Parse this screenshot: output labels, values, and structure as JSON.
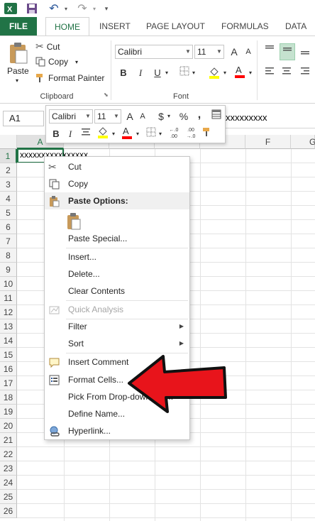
{
  "qat": {
    "undo": "↶",
    "redo": "↷"
  },
  "tabs": [
    {
      "label": "FILE"
    },
    {
      "label": "HOME"
    },
    {
      "label": "INSERT"
    },
    {
      "label": "PAGE LAYOUT"
    },
    {
      "label": "FORMULAS"
    },
    {
      "label": "DATA"
    }
  ],
  "ribbon": {
    "clipboard": {
      "paste": "Paste",
      "cut": "Cut",
      "copy": "Copy",
      "format_painter": "Format Painter",
      "label": "Clipboard"
    },
    "font": {
      "name": "Calibri",
      "size": "11",
      "grow": "A",
      "shrink": "A",
      "bold": "B",
      "italic": "I",
      "underline": "U",
      "label": "Font",
      "fill_color": "#ffff00",
      "font_color": "#ff0000"
    }
  },
  "formula_bar": {
    "name_box": "A1",
    "content": "xxxxxxxxx"
  },
  "grid": {
    "columns": [
      "A",
      "F",
      "G"
    ],
    "rows": [
      "1",
      "2",
      "3",
      "4",
      "5",
      "6",
      "7",
      "8",
      "9",
      "10",
      "11",
      "12",
      "13",
      "14",
      "15",
      "16",
      "17",
      "18",
      "19",
      "20",
      "21",
      "22",
      "23",
      "24",
      "25",
      "26"
    ],
    "a1_value": "xxxxxxxxxxxxxxxx"
  },
  "minibar": {
    "font": "Calibri",
    "size": "11",
    "grow": "A",
    "shrink": "A",
    "currency": "$",
    "percent": "%",
    "comma": ",",
    "bold": "B",
    "italic": "I",
    "inc_decimal": "←.0\n.00",
    "dec_decimal": ".00\n→.0"
  },
  "context_menu": {
    "cut": "Cut",
    "copy": "Copy",
    "paste_options": "Paste Options:",
    "paste_special": "Paste Special...",
    "insert": "Insert...",
    "delete": "Delete...",
    "clear_contents": "Clear Contents",
    "quick_analysis": "Quick Analysis",
    "filter": "Filter",
    "sort": "Sort",
    "insert_comment": "Insert Comment",
    "format_cells": "Format Cells...",
    "pick_from_dropdown": "Pick From Drop-down List...",
    "define_name": "Define Name...",
    "hyperlink": "Hyperlink..."
  },
  "colors": {
    "excel_green": "#217346",
    "annotation_arrow": "#e8141b"
  }
}
